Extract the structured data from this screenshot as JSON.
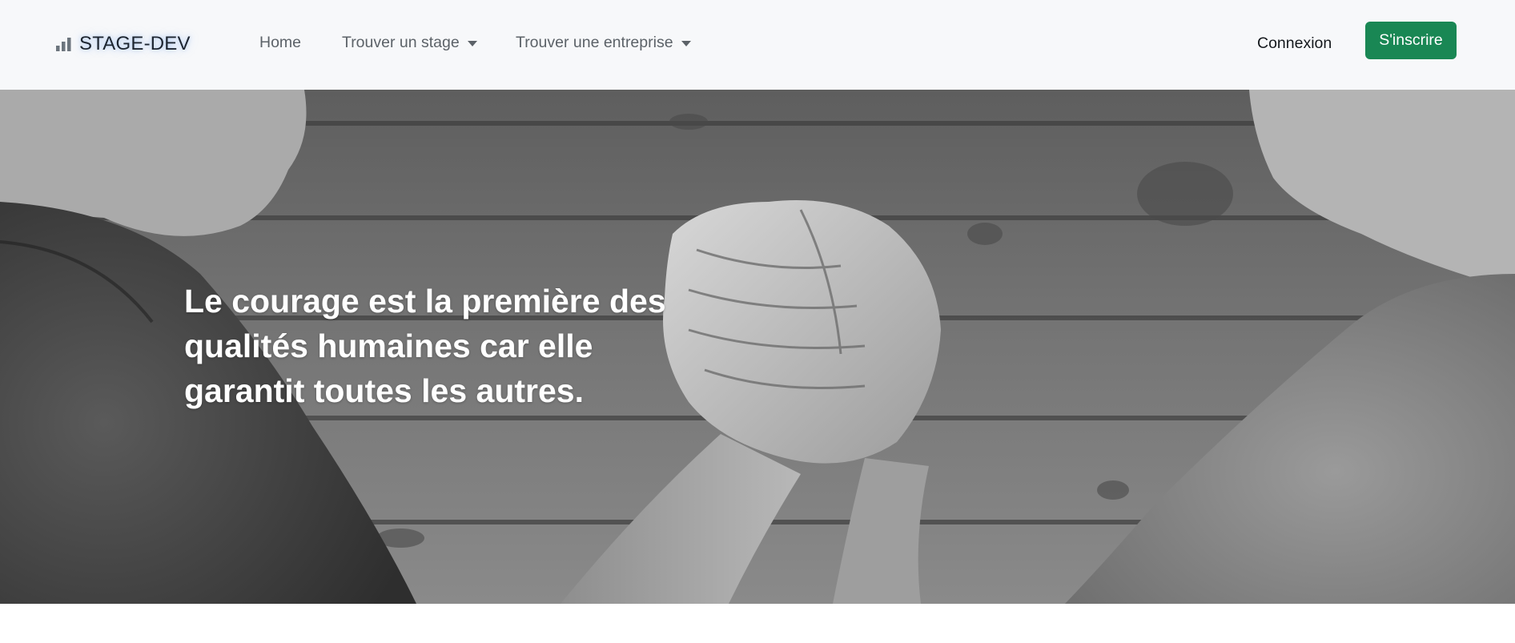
{
  "navbar": {
    "brand": {
      "icon": "bar-chart-icon",
      "label": "STAGE-DEV"
    },
    "items": [
      {
        "label": "Home",
        "has_dropdown": false
      },
      {
        "label": "Trouver un stage",
        "has_dropdown": true
      },
      {
        "label": "Trouver une entreprise",
        "has_dropdown": true
      }
    ],
    "login_label": "Connexion",
    "signup_label": "S'inscrire"
  },
  "hero": {
    "quote": "Le courage est la première des qualités humaines car elle garantit toutes les autres.",
    "image_subject": "arm-wrestling-handshake-photo"
  },
  "colors": {
    "navbar_bg": "#f7f8fa",
    "signup_button": "#198754",
    "text_dark": "#14181c",
    "nav_text": "#5c6268"
  }
}
